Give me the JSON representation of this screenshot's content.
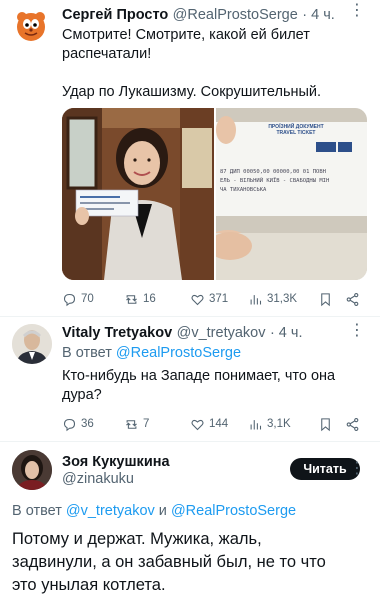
{
  "tweet1": {
    "name": "Сергей Просто",
    "handle": "@RealProstoSerge",
    "time": "· 4 ч.",
    "text_line1": "Смотрите! Смотрите, какой ей билет",
    "text_line2": "распечатали!",
    "text_line3": "Удар по Лукашизму. Сокрушительный.",
    "ticket_title1": "ПРОЇЗНИЙ ДОКУМЕНТ",
    "ticket_title2": "TRAVEL TICKET",
    "ticket_row1": "87 ДИП 00050,00 00000,00 01 ПОВН",
    "ticket_row2": "ЕЛЬ - ВІЛЬНИЙ КИЇВ - СВАБОДНЫ МІН",
    "ticket_row3": "ЧА ТИХАНОВСЬКА",
    "stats": {
      "replies": "70",
      "retweets": "16",
      "likes": "371",
      "views": "31,3K"
    }
  },
  "tweet2": {
    "name": "Vitaly Tretyakov",
    "handle": "@v_tretyakov",
    "time": "· 4 ч.",
    "reply_prefix": "В ответ",
    "reply_to": "@RealProstoSerge",
    "text_line1": "Кто-нибудь на Западе понимает, что она",
    "text_line2": "дура?",
    "stats": {
      "replies": "36",
      "retweets": "7",
      "likes": "144",
      "views": "3,1K"
    }
  },
  "tweet3": {
    "name": "Зоя Кукушкина",
    "handle": "@zinakuku",
    "follow_label": "Читать",
    "reply_prefix": "В ответ",
    "reply_to_1": "@v_tretyakov",
    "reply_and": "и",
    "reply_to_2": "@RealProstoSerge",
    "text_line1": "Потому и держат. Мужика, жаль,",
    "text_line2": "задвинули, а он забавный был, не то что",
    "text_line3": "это унылая котлета."
  },
  "colors": {
    "accent": "#1d9bf0",
    "text": "#0f1419",
    "muted": "#536471"
  },
  "icons": [
    "reply-icon",
    "retweet-icon",
    "like-icon",
    "views-icon",
    "bookmark-icon",
    "share-icon",
    "more-icon"
  ]
}
